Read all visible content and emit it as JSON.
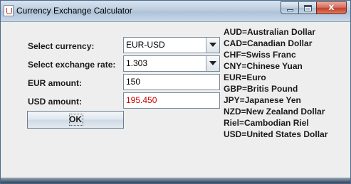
{
  "window": {
    "title": "Currency Exchange Calculator",
    "close_glyph": "x"
  },
  "form": {
    "currency_label": "Select currency:",
    "currency_value": "EUR-USD",
    "rate_label": "Select exchange rate:",
    "rate_value": "1.303",
    "from_label": "EUR amount:",
    "from_value": "150",
    "to_label": "USD amount:",
    "to_value": "195.450",
    "ok_label": "OK"
  },
  "legend": [
    "AUD=Australian Dollar",
    "CAD=Canadian Dollar",
    "CHF=Swiss Franc",
    "CNY=Chinese Yuan",
    "EUR=Euro",
    "GBP=Britis Pound",
    "JPY=Japanese Yen",
    "NZD=New Zealand Dollar",
    "Riel=Cambodian Riel",
    "USD=United States Dollar"
  ],
  "colors": {
    "result_text": "#cc0000",
    "close_button": "#c5402b"
  },
  "icons": {
    "app": "java-cup-icon",
    "minimize": "minimize-icon",
    "maximize": "maximize-icon",
    "close": "close-icon",
    "dropdown": "chevron-down-icon"
  }
}
